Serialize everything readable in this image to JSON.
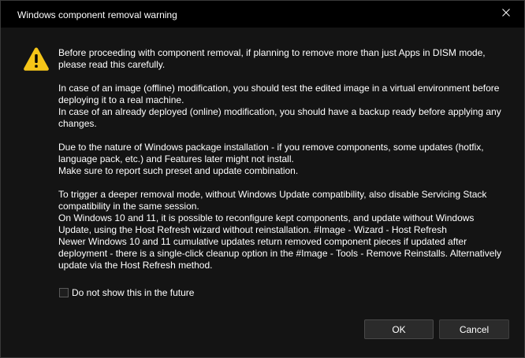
{
  "dialog": {
    "title": "Windows component removal warning",
    "icon": "warning-icon",
    "paragraphs": [
      "Before proceeding with component removal, if planning to remove more than just Apps in DISM mode,\nplease read this carefully.",
      "In case of an image (offline) modification, you should test the edited image in a virtual environment before\ndeploying it to a real machine.\nIn case of an already deployed (online) modification, you should have a backup ready before applying any\nchanges.",
      "Due to the nature of Windows package installation - if you remove components, some updates (hotfix,\nlanguage pack, etc.) and Features later might not install.\nMake sure to report such preset and update combination.",
      "To trigger a deeper removal mode, without Windows Update compatibility, also disable Servicing Stack\ncompatibility in the same session.\nOn Windows 10 and 11, it is possible to reconfigure kept components, and update without Windows\nUpdate, using the Host Refresh wizard without reinstallation. #Image - Wizard - Host Refresh\nNewer Windows 10 and 11 cumulative updates return removed component pieces if updated after\ndeployment - there is a single-click cleanup option in the #Image - Tools - Remove Reinstalls. Alternatively\nupdate via the Host Refresh method."
    ],
    "checkbox": {
      "label": "Do not show this in the future",
      "checked": false
    },
    "buttons": {
      "ok": "OK",
      "cancel": "Cancel"
    }
  },
  "colors": {
    "titlebar_bg": "#000000",
    "content_bg": "#141414",
    "button_bg": "#2b2b2b",
    "warning_yellow": "#f5c518"
  }
}
